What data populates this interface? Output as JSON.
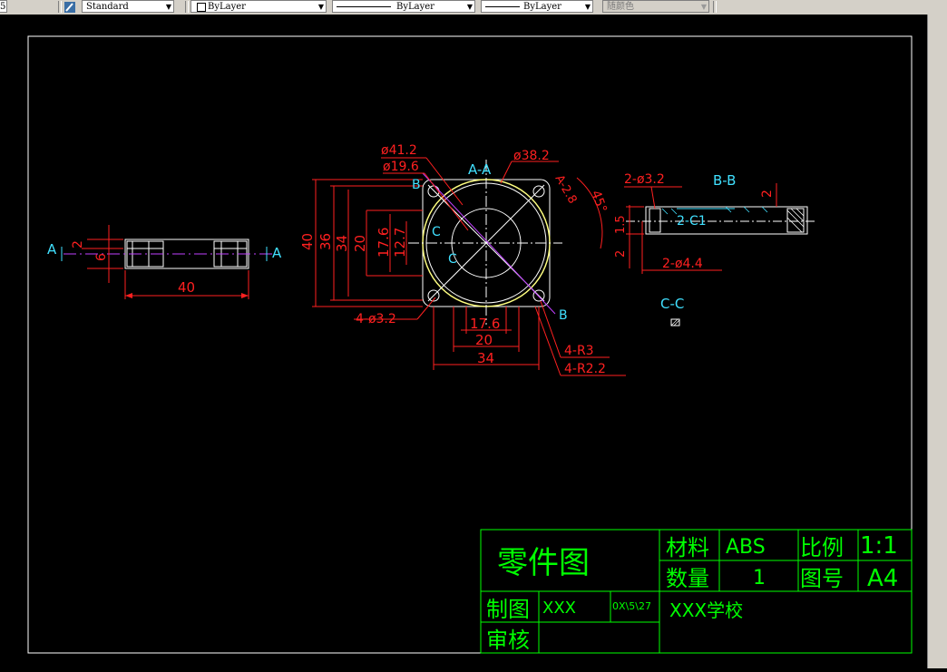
{
  "toolbar": {
    "left_fragment": "5",
    "text_style": "Standard",
    "layer": "ByLayer",
    "linetype": "ByLayer",
    "lineweight": "ByLayer",
    "color": "随颜色"
  },
  "drawing": {
    "side_view": {
      "section_label_left": "A",
      "section_label_right": "A",
      "dim_small_1": "2",
      "dim_small_2": "6",
      "dim_width": "40"
    },
    "front_view": {
      "dim_d41": "ø41.2",
      "dim_d19": "ø19.6",
      "section_aa": "A-A",
      "dim_d38": "ø38.2",
      "dim_a28": "A-2.8",
      "dim_45": "45°",
      "label_b_top": "B",
      "label_b_bottom": "B",
      "label_c_top": "C",
      "label_c_bottom": "C",
      "dim_40": "40",
      "dim_36": "36",
      "dim_34v": "34",
      "dim_20v": "20",
      "dim_176v": "17.6",
      "dim_127": "12.7",
      "dim_4holes": "4-ø3.2",
      "dim_176h": "17.6",
      "dim_20h": "20",
      "dim_34h": "34",
      "dim_r3": "4-R3",
      "dim_r22": "4-R2.2"
    },
    "section_bb": {
      "title": "B-B",
      "dim_holes": "2-ø3.2",
      "dim_2": "2",
      "dim_15": "1.5",
      "dim_2b": "2",
      "dim_c1": "2-C1",
      "dim_44": "2-ø4.4"
    },
    "section_cc": {
      "title": "C-C"
    }
  },
  "title_block": {
    "part_name": "零件图",
    "material_label": "材料",
    "material_value": "ABS",
    "scale_label": "比例",
    "scale_value": "1:1",
    "qty_label": "数量",
    "qty_value": "1",
    "drawing_no_label": "图号",
    "drawing_no_value": "A4",
    "drawn_by_label": "制图",
    "drawn_by_value": "XXX",
    "date_value": "0X\\5\\27",
    "school": "XXX学校",
    "checked_label": "审核"
  }
}
